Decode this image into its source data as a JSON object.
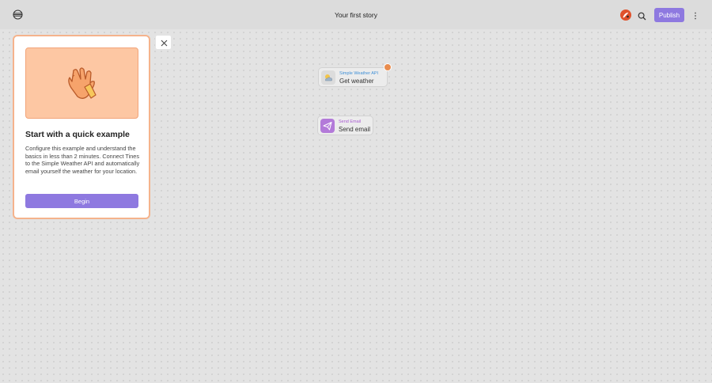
{
  "header": {
    "story_title": "Your first story",
    "publish_label": "Publish"
  },
  "onboarding": {
    "title": "Start with a quick example",
    "description": "Configure this example and understand the basics in less than 2 minutes. Connect Tines to the Simple Weather API and automatically email yourself the weather for your location.",
    "begin_label": "Begin"
  },
  "nodes": [
    {
      "type": "Simple Weather API",
      "name": "Get weather",
      "icon": "weather-icon",
      "type_color": "#3f8fd6"
    },
    {
      "type": "Send Email",
      "name": "Send email",
      "icon": "send-icon",
      "type_color": "#a85ad0"
    }
  ],
  "colors": {
    "accent": "#8e79e0",
    "panel_border": "#f5b38c",
    "hero_bg": "#fdc7a3",
    "badge": "#e98c4e"
  }
}
